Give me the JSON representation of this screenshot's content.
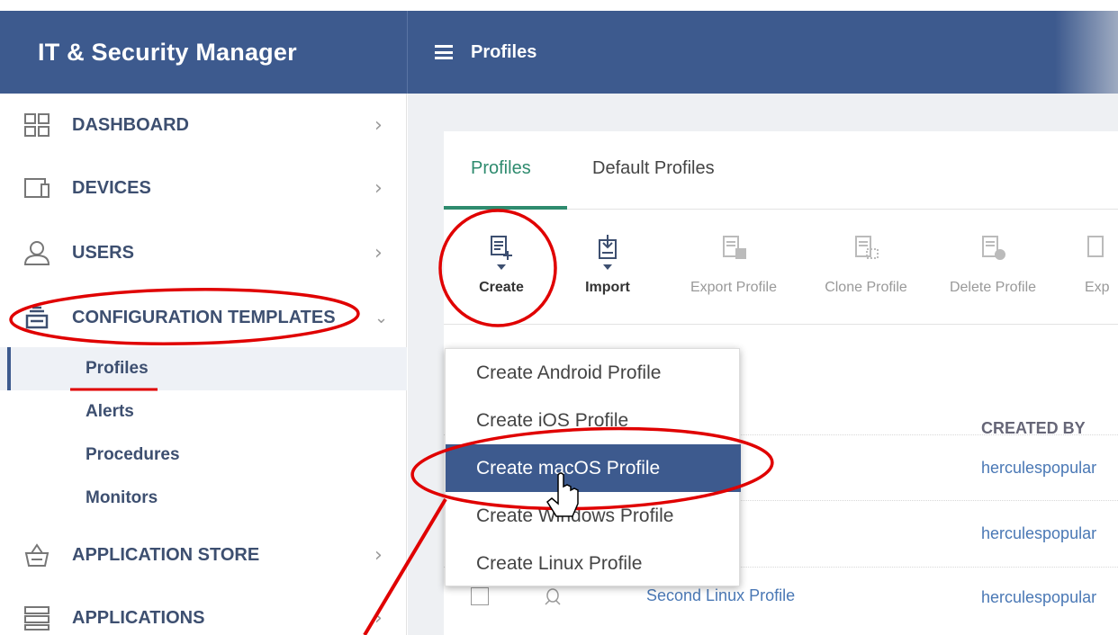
{
  "app": {
    "title": "IT & Security Manager"
  },
  "header": {
    "page_title": "Profiles"
  },
  "sidebar": {
    "items": [
      {
        "label": "DASHBOARD",
        "icon": "dashboard-icon",
        "chevron": "›"
      },
      {
        "label": "DEVICES",
        "icon": "devices-icon",
        "chevron": "›"
      },
      {
        "label": "USERS",
        "icon": "user-icon",
        "chevron": "›"
      },
      {
        "label": "CONFIGURATION TEMPLATES",
        "icon": "templates-icon",
        "chevron": "⌄"
      },
      {
        "label": "APPLICATION STORE",
        "icon": "store-icon",
        "chevron": "›"
      },
      {
        "label": "APPLICATIONS",
        "icon": "applications-icon",
        "chevron": "›"
      }
    ],
    "sub_items": [
      {
        "label": "Profiles",
        "active": true
      },
      {
        "label": "Alerts"
      },
      {
        "label": "Procedures"
      },
      {
        "label": "Monitors"
      }
    ]
  },
  "tabs": [
    {
      "label": "Profiles",
      "active": true
    },
    {
      "label": "Default Profiles"
    }
  ],
  "toolbar": {
    "create": "Create",
    "import": "Import",
    "export_profile": "Export Profile",
    "clone_profile": "Clone Profile",
    "delete_profile": "Delete Profile",
    "export_truncated": "Exp"
  },
  "table": {
    "created_by_header": "CREATED BY",
    "rows": [
      {
        "created_by": "herculespopular"
      },
      {
        "created_by": "herculespopular"
      },
      {
        "name": "Second Linux Profile",
        "created_by": "herculespopular"
      }
    ]
  },
  "dropdown": {
    "items": [
      "Create Android Profile",
      "Create iOS Profile",
      "Create macOS Profile",
      "Create Windows Profile",
      "Create Linux Profile"
    ],
    "highlighted_index": 2
  },
  "colors": {
    "header_bg": "#3d5a8e",
    "accent_green": "#2e8b6e",
    "annotation_red": "#e00000",
    "link_blue": "#4a78b5"
  }
}
